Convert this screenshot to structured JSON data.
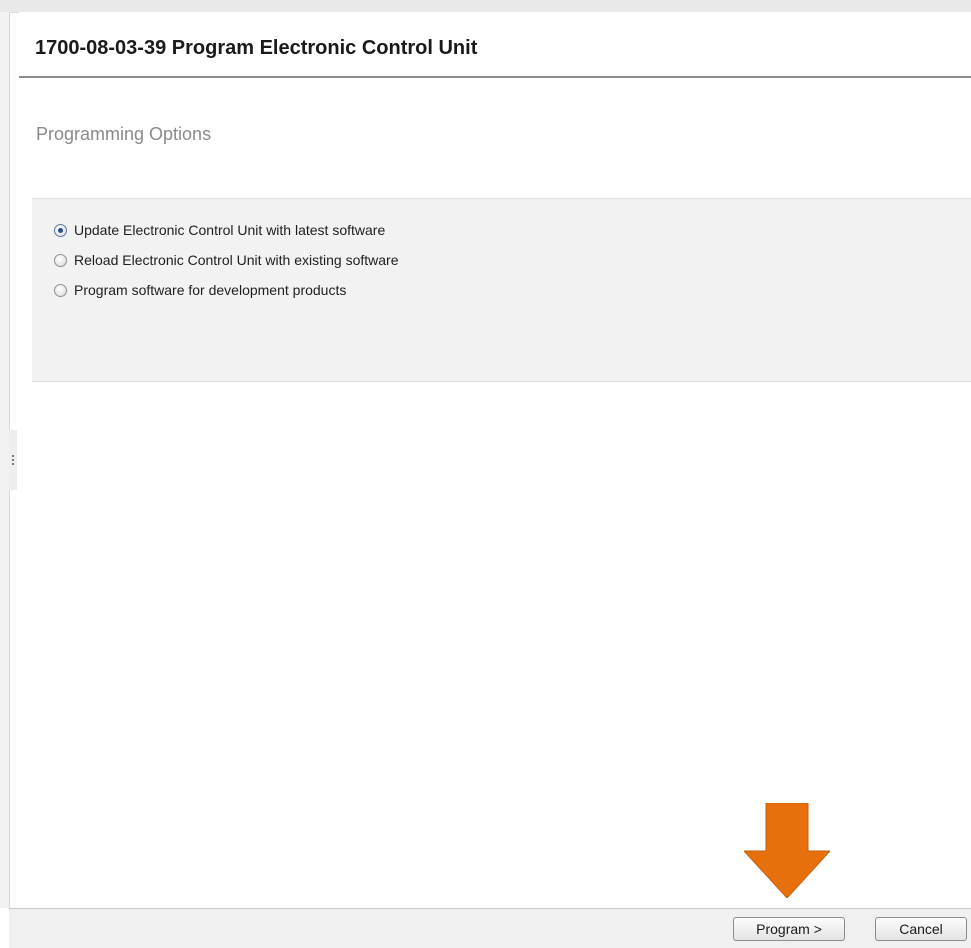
{
  "dialog": {
    "title": "1700-08-03-39 Program Electronic Control Unit",
    "section_title": "Programming Options"
  },
  "options": [
    {
      "label": "Update Electronic Control Unit with latest software",
      "selected": true
    },
    {
      "label": "Reload Electronic Control Unit with existing software",
      "selected": false
    },
    {
      "label": "Program software for development products",
      "selected": false
    }
  ],
  "footer": {
    "program_label": "Program >",
    "cancel_label": "Cancel"
  },
  "annotation": {
    "arrow_icon": "down-arrow-icon",
    "arrow_color": "#e8700c"
  }
}
